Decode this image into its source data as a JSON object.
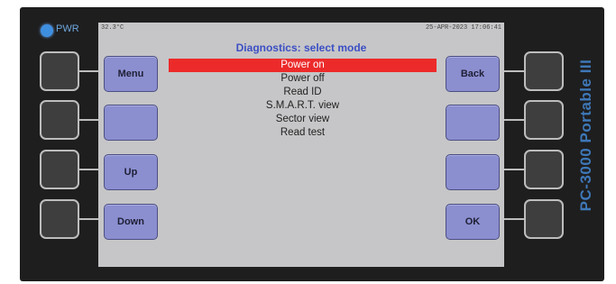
{
  "device": {
    "power_label": "PWR",
    "brand": "PC-3000 Portable III",
    "led_color": "#3f8fe0"
  },
  "screen": {
    "status_left": "32.3°C",
    "status_right": "25-APR-2023 17:06:41",
    "title": "Diagnostics: select mode",
    "menu_items": [
      {
        "label": "Power on",
        "selected": true
      },
      {
        "label": "Power off",
        "selected": false
      },
      {
        "label": "Read ID",
        "selected": false
      },
      {
        "label": "S.M.A.R.T. view",
        "selected": false
      },
      {
        "label": "Sector view",
        "selected": false
      },
      {
        "label": "Read test",
        "selected": false
      }
    ],
    "highlight_color": "#ec2a2a",
    "title_color": "#3c4fc4"
  },
  "softkeys": {
    "left": [
      "Menu",
      "",
      "Up",
      "Down"
    ],
    "right": [
      "Back",
      "",
      "",
      "OK"
    ]
  }
}
